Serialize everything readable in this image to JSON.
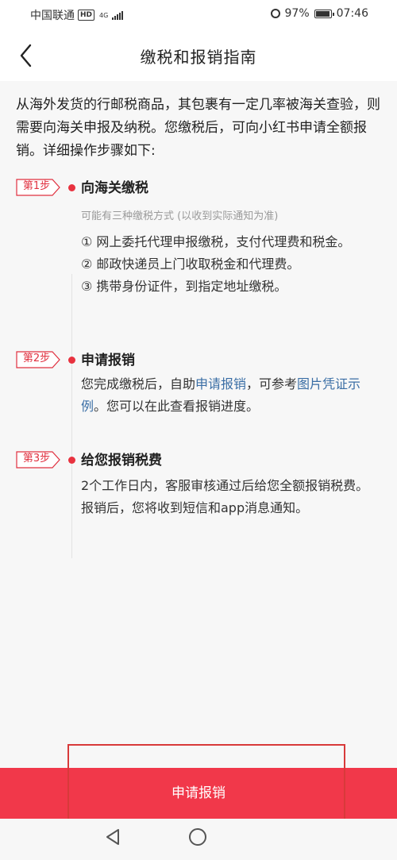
{
  "status_bar": {
    "carrier": "中国联通",
    "hd": "HD",
    "network": "4G",
    "battery": "97%",
    "battery_level": 0.97,
    "time": "07:46"
  },
  "header": {
    "title": "缴税和报销指南"
  },
  "intro": "从海外发货的行邮税商品，其包裹有一定几率被海关查验，则需要向海关申报及纳税。您缴税后，可向小红书申请全额报销。详细操作步骤如下:",
  "steps": [
    {
      "badge": "第1步",
      "title": "向海关缴税",
      "subtitle": "可能有三种缴税方式 (以收到实际通知为准)",
      "items": [
        "① 网上委托代理申报缴税，支付代理费和税金。",
        "② 邮政快递员上门收取税金和代理费。",
        "③ 携带身份证件，到指定地址缴税。"
      ]
    },
    {
      "badge": "第2步",
      "title": "申请报销",
      "body_pre": "您完成缴税后，自助",
      "link1": "申请报销",
      "body_mid": "，可参考",
      "link2": "图片凭证示例",
      "body_post": "。您可以在此查看报销进度。"
    },
    {
      "badge": "第3步",
      "title": "给您报销税费",
      "body": "2个工作日内，客服审核通过后给您全额报销税费。报销后，您将收到短信和app消息通知。"
    }
  ],
  "cta": {
    "label": "申请报销"
  },
  "colors": {
    "accent": "#f1384a",
    "link": "#3a6ea5",
    "badge": "#e0303f"
  }
}
